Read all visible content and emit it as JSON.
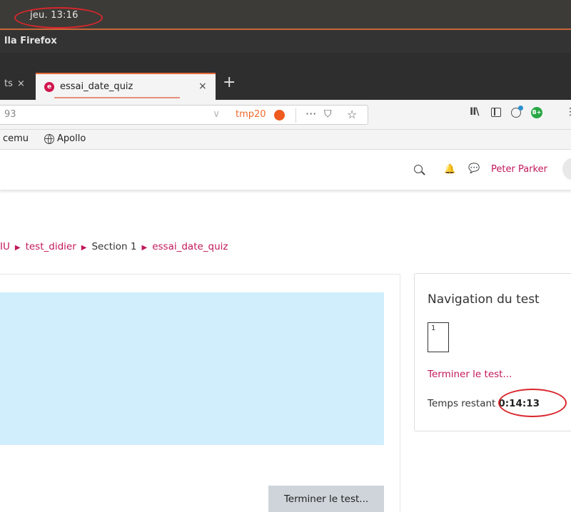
{
  "system": {
    "clock": "jeu. 13:16"
  },
  "window": {
    "title": "lla Firefox"
  },
  "tabs": {
    "previous_label": "ts",
    "previous_close": "×",
    "active_label": "essai_date_quiz",
    "active_favicon": "e",
    "active_close": "×",
    "new_tab": "+"
  },
  "urlbar": {
    "url_fragment": "93",
    "chevron": "∨",
    "container_label": "tmp20",
    "more": "···",
    "pocket": "⛉",
    "star": "☆"
  },
  "toolbar": {
    "library": "II\\",
    "ext_badge": "B+",
    "overflow": "⋮"
  },
  "bookmarks": {
    "items": [
      "cemu",
      "Apollo"
    ]
  },
  "header": {
    "bell": "🔔",
    "chat": "💬",
    "user_name": "Peter Parker"
  },
  "breadcrumb": {
    "items": [
      "IU",
      "test_didier",
      "Section 1",
      "essai_date_quiz"
    ],
    "separator": "▶"
  },
  "quiz": {
    "finish_button_label": "Terminer le test..."
  },
  "quiz_navigation": {
    "title": "Navigation du test",
    "question_number": "1",
    "finish_link": "Terminer le test...",
    "time_label": "Temps restant",
    "time_value": "0:14:13"
  },
  "colors": {
    "accent": "#c2185b",
    "question_bg": "#d0eefb",
    "annotation": "#d9262c",
    "container": "#ef5a1e"
  }
}
